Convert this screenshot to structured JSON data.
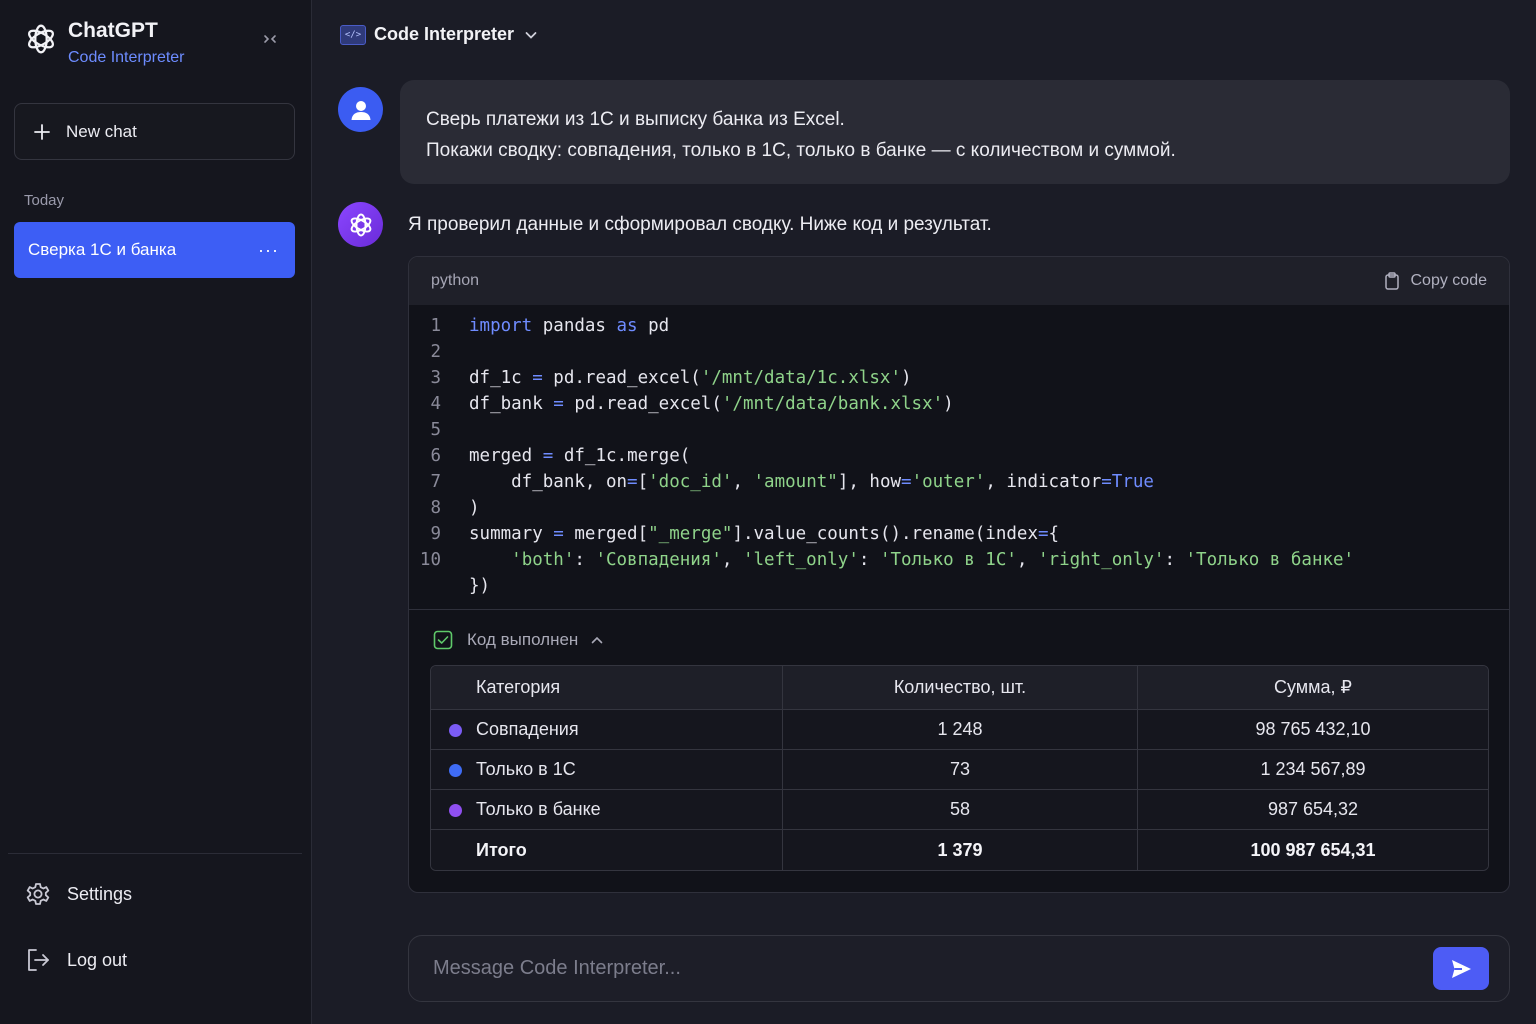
{
  "sidebar": {
    "brand_title": "ChatGPT",
    "brand_subtitle": "Code Interpreter",
    "new_chat_label": "New chat",
    "section_today": "Today",
    "active_chat": "Сверка 1С и банка",
    "more_label": "···",
    "settings_label": "Settings",
    "logout_label": "Log out"
  },
  "header": {
    "model_title": "Code Interpreter",
    "model_icon_text": "</>"
  },
  "conversation": {
    "user_message_line1": "Сверь платежи из 1С и выписку банка из Excel.",
    "user_message_line2": "Покажи сводку: совпадения, только в 1С, только в банке — с количеством и суммой.",
    "assistant_intro": "Я проверил данные и сформировал сводку. Ниже код и результат."
  },
  "code_block": {
    "language": "python",
    "copy_label": "Copy code",
    "line_numbers": [
      "1",
      "2",
      "3",
      "4",
      "5",
      "6",
      "7",
      "8",
      "9",
      "10",
      ""
    ]
  },
  "result": {
    "status_label": "Код выполнен",
    "headers": [
      "Категория",
      "Количество, шт.",
      "Сумма, ₽"
    ],
    "rows": [
      {
        "category": "Совпадения",
        "count": "1 248",
        "sum": "98 765 432,10",
        "color": "#7b5cf5"
      },
      {
        "category": "Только в 1С",
        "count": "73",
        "sum": "1 234 567,89",
        "color": "#3f6cf5"
      },
      {
        "category": "Только в банке",
        "count": "58",
        "sum": "987 654,32",
        "color": "#8f4ff0"
      }
    ],
    "total": {
      "category": "Итого",
      "count": "1 379",
      "sum": "100 987 654,31"
    }
  },
  "composer": {
    "placeholder": "Message Code Interpreter..."
  },
  "colors": {
    "accent": "#3d5ef5",
    "link": "#6d8cff",
    "keyword": "#6f8cff",
    "string": "#8fd38a",
    "success": "#5fc96a"
  }
}
